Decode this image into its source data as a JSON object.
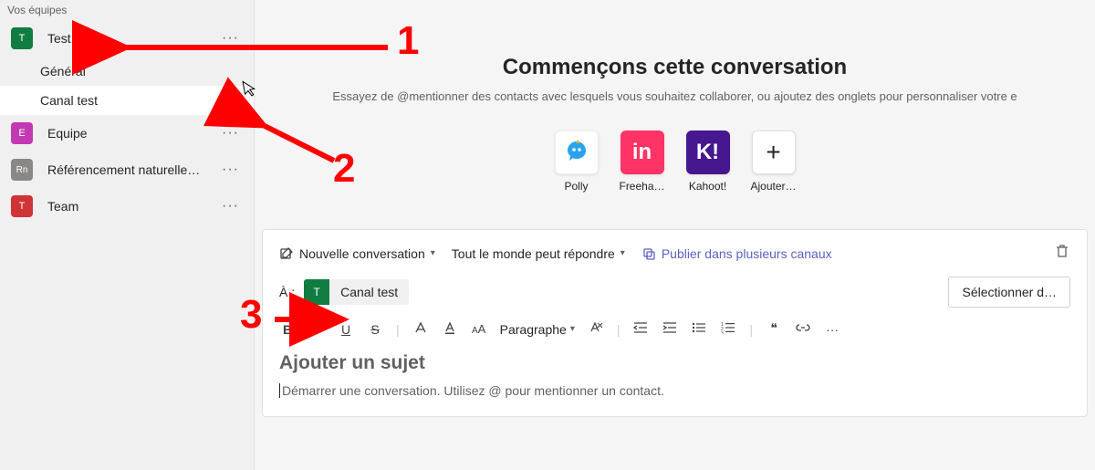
{
  "sidebar": {
    "header": "Vos équipes",
    "teams": [
      {
        "avatar_bg": "#107c41",
        "initial": "T",
        "name": "Test",
        "channels": [
          "Général",
          "Canal test"
        ],
        "selected_channel_idx": 1
      },
      {
        "avatar_bg": "#c239b3",
        "initial": "E",
        "name": "Equipe"
      },
      {
        "avatar_bg": "#8a8886",
        "initial": "Rn",
        "name": "Référencement naturelle…"
      },
      {
        "avatar_bg": "#d13438",
        "initial": "T",
        "name": "Team"
      }
    ]
  },
  "welcome": {
    "title": "Commençons cette conversation",
    "subtitle": "Essayez de @mentionner des contacts avec lesquels vous souhaitez collaborer, ou ajoutez des onglets pour personnaliser votre e"
  },
  "apps": [
    {
      "label": "Polly",
      "bg": "#ffffff",
      "fg": "#2aa3ef",
      "glyph": "㋡"
    },
    {
      "label": "Freeha…",
      "bg": "#ff3366",
      "fg": "#ffffff",
      "glyph": "in"
    },
    {
      "label": "Kahoot!",
      "bg": "#46178f",
      "fg": "#ffffff",
      "glyph": "K!"
    },
    {
      "label": "Ajouter…",
      "bg": "#ffffff",
      "fg": "#252525",
      "glyph": "+"
    }
  ],
  "composer": {
    "new_conv": "Nouvelle conversation",
    "reply_scope": "Tout le monde peut répondre",
    "publish": "Publier dans plusieurs canaux",
    "to_label": "À :",
    "chip": {
      "initial": "T",
      "label": "Canal test"
    },
    "select_button": "Sélectionner d…",
    "paragraph": "Paragraphe",
    "subject_placeholder": "Ajouter un sujet",
    "body_placeholder": "Démarrer une conversation. Utilisez @ pour mentionner un contact."
  },
  "annotations": {
    "n1": "1",
    "n2": "2",
    "n3": "3"
  }
}
